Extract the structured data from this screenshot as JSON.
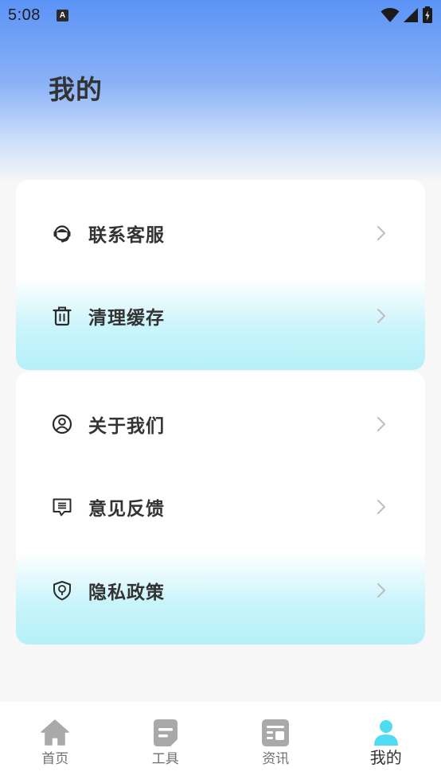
{
  "status_bar": {
    "time": "5:08",
    "notification_icon": "a-icon",
    "icons": [
      "wifi-icon",
      "signal-icon",
      "battery-icon"
    ]
  },
  "page": {
    "title": "我的"
  },
  "menu_groups": [
    {
      "items": [
        {
          "label": "联系客服",
          "icon": "headset-icon"
        },
        {
          "label": "清理缓存",
          "icon": "trash-icon"
        }
      ]
    },
    {
      "items": [
        {
          "label": "关于我们",
          "icon": "user-circle-icon"
        },
        {
          "label": "意见反馈",
          "icon": "message-icon"
        },
        {
          "label": "隐私政策",
          "icon": "shield-icon"
        }
      ]
    }
  ],
  "bottom_nav": {
    "active": "我的",
    "items": [
      {
        "label": "首页",
        "icon": "home-icon"
      },
      {
        "label": "工具",
        "icon": "tools-icon"
      },
      {
        "label": "资讯",
        "icon": "news-icon"
      },
      {
        "label": "我的",
        "icon": "person-icon"
      }
    ]
  },
  "colors": {
    "header_gradient_top": "#5b93f6",
    "accent_cyan": "#b6f0f8",
    "active_nav_icon": "#4fdcf3",
    "inactive_nav_icon": "#a9a9a9"
  }
}
